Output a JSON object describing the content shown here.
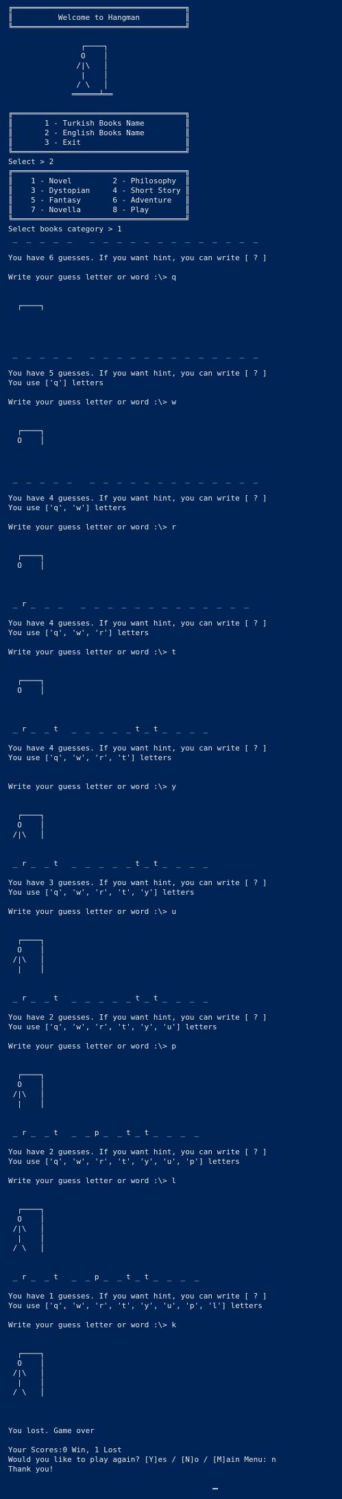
{
  "console_lines": [
    "╔══════════════════════════════════════╗",
    "║          Welcome to Hangman          ║",
    "╚══════════════════════════════════════╝",
    "",
    "                ┌────┐",
    "                O    │",
    "               /|\\   │",
    "                |    │",
    "               / \\   │",
    "              ══════╧══",
    "",
    "╔══════════════════════════════════════╗",
    "║       1 - Turkish Books Name         ║",
    "║       2 - English Books Name         ║",
    "║       3 - Exit                       ║",
    "╚══════════════════════════════════════╝",
    "Select > 2",
    "╔══════════════════════════════════════╗",
    "║    1 - Novel         2 - Philosophy  ║",
    "║    3 - Dystopian     4 - Short Story ║",
    "║    5 - Fantasy       6 - Adventure   ║",
    "║    7 - Novella       8 - Play        ║",
    "╚══════════════════════════════════════╝",
    "Select books category > 1",
    " _  _  _  _  _    _  _  _  _  _  _  _  _  _  _  _  _  _",
    "",
    "You have 6 guesses. If you want hint, you can write [ ? ]",
    "",
    "Write your guess letter or word :\\> q",
    "",
    "",
    "  ┌────┐",
    "",
    "",
    "",
    "",
    " _  _  _  _  _    _  _  _  _  _  _  _  _  _  _  _  _  _",
    "",
    "You have 5 guesses. If you want hint, you can write [ ? ]",
    "You use ['q'] letters",
    "",
    "Write your guess letter or word :\\> w",
    "",
    "",
    "  ┌────┐",
    "  O    │",
    "",
    "",
    "",
    " _  _  _  _  _    _  _  _  _  _  _  _  _  _  _  _  _  _",
    "",
    "You have 4 guesses. If you want hint, you can write [ ? ]",
    "You use ['q', 'w'] letters",
    "",
    "Write your guess letter or word :\\> r",
    "",
    "",
    "  ┌────┐",
    "  O    │",
    "",
    "",
    "",
    " _ r _  _  _    _  _  _  _  _  _  _  _  _  _  _  _  _",
    "",
    "You have 4 guesses. If you want hint, you can write [ ? ]",
    "You use ['q', 'w', 'r'] letters",
    "",
    "Write your guess letter or word :\\> t",
    "",
    "",
    "  ┌────┐",
    "  O    │",
    "",
    "",
    "",
    " _ r _  _ t   _  _  _  _  _ t _ t _  _  _  _",
    "",
    "You have 4 guesses. If you want hint, you can write [ ? ]",
    "You use ['q', 'w', 'r', 't'] letters",
    "",
    "",
    "Write your guess letter or word :\\> y",
    "",
    "",
    "  ┌────┐",
    "  O    │",
    " /|\\   │",
    "",
    "",
    " _ r _  _ t   _  _  _  _  _ t _ t _  _  _  _",
    "",
    "You have 3 guesses. If you want hint, you can write [ ? ]",
    "You use ['q', 'w', 'r', 't', 'y'] letters",
    "",
    "Write your guess letter or word :\\> u",
    "",
    "",
    "  ┌────┐",
    "  O    │",
    " /|\\   │",
    "  |    │",
    "",
    "",
    " _ r _  _ t   _  _  _  _  _ t _ t _  _  _  _",
    "",
    "You have 2 guesses. If you want hint, you can write [ ? ]",
    "You use ['q', 'w', 'r', 't', 'y', 'u'] letters",
    "",
    "Write your guess letter or word :\\> p",
    "",
    "",
    "  ┌────┐",
    "  O    │",
    " /|\\   │",
    "  |    │",
    "",
    "",
    " _ r _  _ t   _  _ p _  _ t _ t _  _  _  _",
    "",
    "You have 2 guesses. If you want hint, you can write [ ? ]",
    "You use ['q', 'w', 'r', 't', 'y', 'u', 'p'] letters",
    "",
    "Write your guess letter or word :\\> l",
    "",
    "",
    "  ┌────┐",
    "  O    │",
    " /|\\   │",
    "  |    │",
    " / \\   │",
    "",
    "",
    " _ r _  _ t   _  _ p _  _ t _ t _  _  _  _",
    "",
    "You have 1 guesses. If you want hint, you can write [ ? ]",
    "You use ['q', 'w', 'r', 't', 'y', 'u', 'p', 'l'] letters",
    "",
    "Write your guess letter or word :\\> k",
    "",
    "",
    "  ┌────┐",
    "  O    │",
    " /|\\   │",
    "  |    │",
    " / \\   │",
    "",
    "",
    "",
    "You lost. Game over",
    "",
    "Your Scores:0 Win, 1 Lost",
    "Would you like to play again? [Y]es / [N]o / [M]ain Menu: n",
    "Thank you!"
  ],
  "colors": {
    "background": "#012456",
    "text": "#e6e6e6"
  }
}
